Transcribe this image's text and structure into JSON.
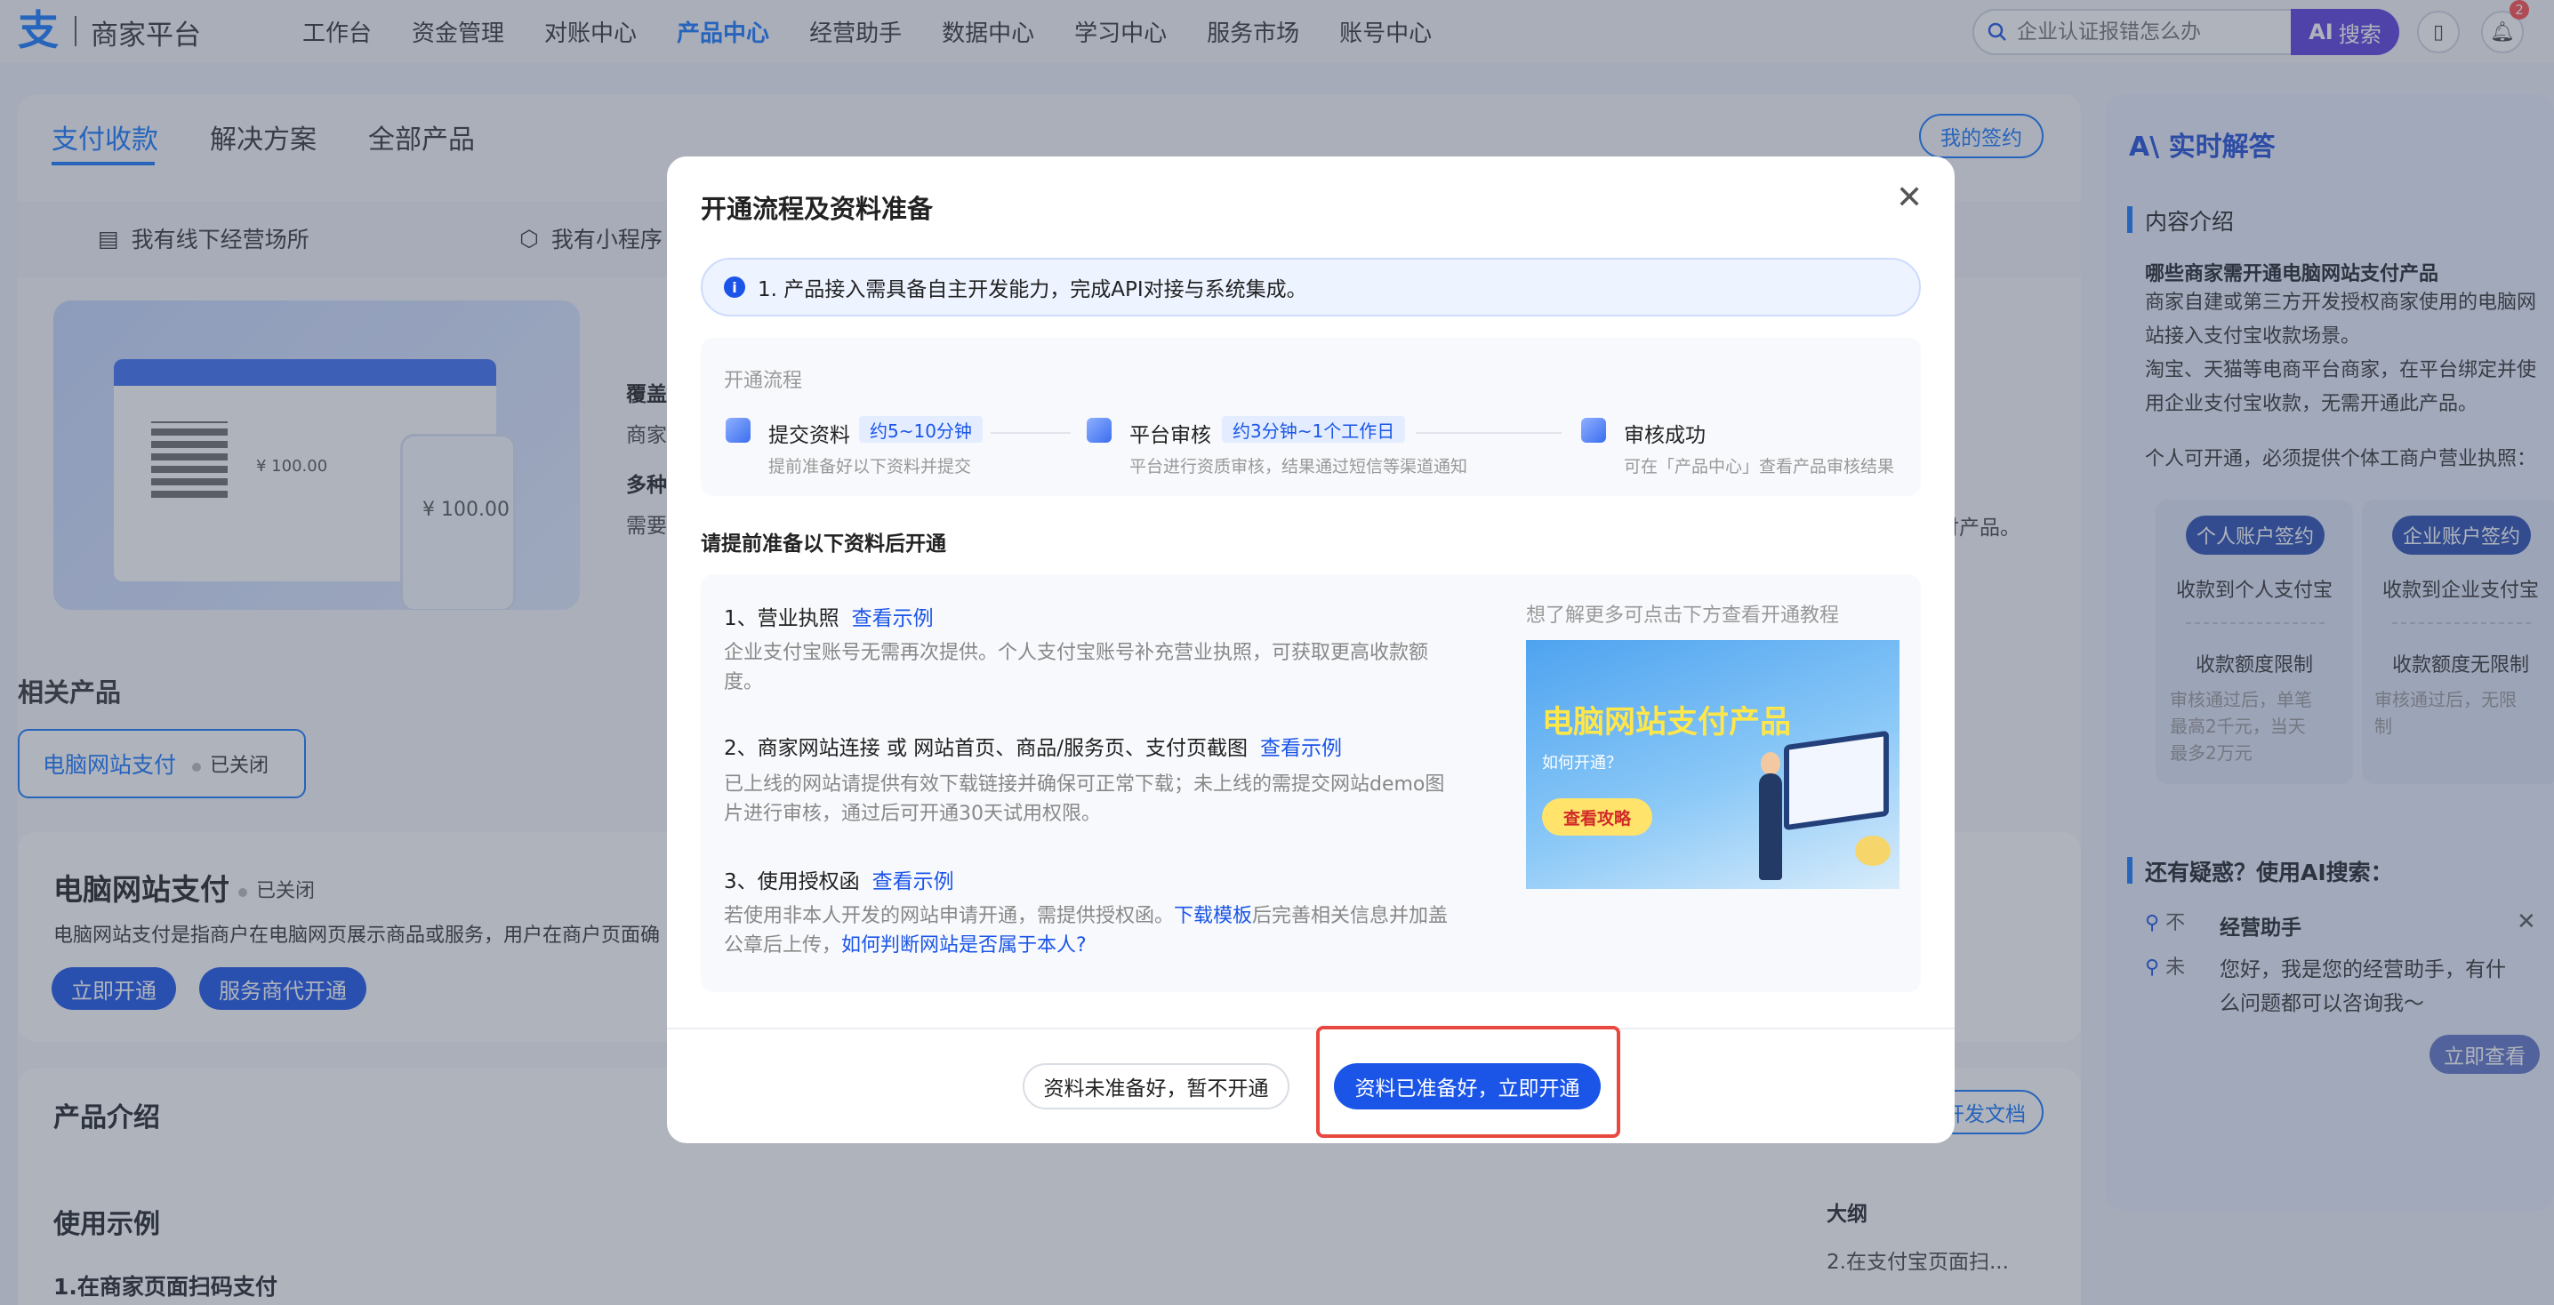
{
  "header": {
    "logo_text": "商家平台",
    "nav": [
      "工作台",
      "资金管理",
      "对账中心",
      "产品中心",
      "经营助手",
      "数据中心",
      "学习中心",
      "服务市场",
      "账号中心"
    ],
    "active_nav_index": 3,
    "search_placeholder": "企业认证报错怎么办",
    "search_button": "搜索",
    "notification_count": "2"
  },
  "tabs": [
    "支付收款",
    "解决方案",
    "全部产品"
  ],
  "signed_button": "我的签约",
  "scenes": [
    "我有线下经营场所",
    "我有小程序"
  ],
  "banner": {
    "amount_small": "¥ 100.00",
    "amount_large": "¥ 100.00",
    "side_a": "覆盖",
    "side_b": "商家",
    "side_c": "多种",
    "side_d": "需要",
    "tail_text": "付产品。"
  },
  "related": {
    "title": "相关产品",
    "card_name": "电脑网站支付",
    "card_state": "已关闭"
  },
  "product": {
    "title": "电脑网站支付",
    "state": "已关闭",
    "desc": "电脑网站支付是指商户在电脑网页展示商品或服务，用户在商户页面确",
    "open_btn": "立即开通",
    "agent_btn": "服务商代开通"
  },
  "intro": {
    "title": "产品介绍",
    "devdoc": "开发文档",
    "example_title": "使用示例",
    "example_sub": "1.在商家页面扫码支付",
    "outline_title": "大纲",
    "outline_item": "2.在支付宝页面扫..."
  },
  "right_panel": {
    "title": "实时解答",
    "section": "内容介绍",
    "question": "哪些商家需开通电脑网站支付产品",
    "para1": "商家自建或第三方开发授权商家使用的电脑网站接入支付宝收款场景。",
    "para2": "淘宝、天猫等电商平台商家，在平台绑定并使用企业支付宝收款，无需开通此产品。",
    "para3": "个人可开通，必须提供个体工商户营业执照：",
    "personal": {
      "btn": "个人账户签约",
      "row1": "收款到个人支付宝",
      "row2": "收款额度限制",
      "note": "审核通过后，单笔最高2千元，当天最多2万元"
    },
    "company": {
      "btn": "企业账户签约",
      "row1": "收款到企业支付宝",
      "row2": "收款额度无限制",
      "note": "审核通过后，无限制"
    },
    "more_title": "还有疑惑？使用AI搜索：",
    "search_lines": [
      "不",
      "未"
    ],
    "assistant": {
      "title": "经营助手",
      "text": "您好，我是您的经营助手，有什么问题都可以咨询我～",
      "button": "立即查看"
    }
  },
  "modal": {
    "title": "开通流程及资料准备",
    "notice": "1. 产品接入需具备自主开发能力，完成API对接与系统集成。",
    "flow_label": "开通流程",
    "steps": [
      {
        "name": "提交资料",
        "tag": "约5~10分钟",
        "desc": "提前准备好以下资料并提交"
      },
      {
        "name": "平台审核",
        "tag": "约3分钟~1个工作日",
        "desc": "平台进行资质审核，结果通过短信等渠道通知"
      },
      {
        "name": "审核成功",
        "tag": "",
        "desc": "可在「产品中心」查看产品审核结果"
      }
    ],
    "prep_title": "请提前准备以下资料后开通",
    "docs": [
      {
        "head": "1、营业执照",
        "link": "查看示例",
        "body": "企业支付宝账号无需再次提供。个人支付宝账号补充营业执照，可获取更高收款额度。"
      },
      {
        "head": "2、商家网站连接 或 网站首页、商品/服务页、支付页截图",
        "link": "查看示例",
        "body": "已上线的网站请提供有效下载链接并确保可正常下载；未上线的需提交网站demo图片进行审核，通过后可开通30天试用权限。"
      },
      {
        "head": "3、使用授权函",
        "link": "查看示例",
        "body_pre": "若使用非本人开发的网站申请开通，需提供授权函。",
        "body_link1": "下载模板",
        "body_mid": "后完善相关信息并加盖公章后上传，",
        "body_link2": "如何判断网站是否属于本人?"
      }
    ],
    "tutorial": {
      "label": "想了解更多可点击下方查看开通教程",
      "title": "电脑网站支付产品",
      "sub": "如何开通？",
      "btn": "查看攻略"
    },
    "btn_secondary": "资料未准备好，暂不开通",
    "btn_primary": "资料已准备好，立即开通"
  },
  "colors": {
    "primary": "#1a55e8",
    "link": "#1677ff",
    "highlight": "#e8483f"
  }
}
